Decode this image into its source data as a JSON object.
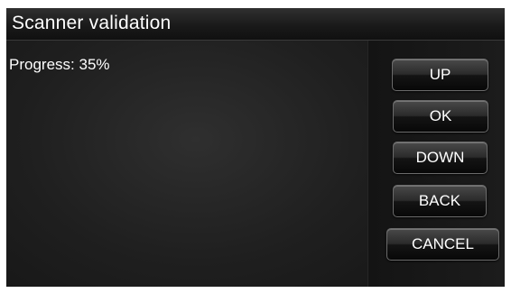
{
  "window": {
    "title": "Scanner validation"
  },
  "main": {
    "progress_label": "Progress:",
    "progress_value": "35%",
    "progress_fraction": 0.35
  },
  "buttons": {
    "up": "UP",
    "ok": "OK",
    "down": "DOWN",
    "back": "BACK",
    "cancel": "CANCEL"
  },
  "colors": {
    "background": "#121212",
    "text": "#ffffff",
    "button_border": "#6b6b6b"
  }
}
